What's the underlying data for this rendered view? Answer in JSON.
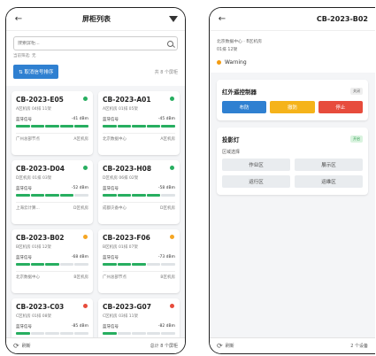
{
  "list_screen": {
    "title": "屏柜列表",
    "search_placeholder": "搜索屏柜...",
    "filter_note": "当前筛选: 无",
    "cancel_sort_label": "取消信号排序",
    "count_text": "共 8 个屏柜",
    "cards": [
      {
        "id": "CB-2023-E05",
        "sub": "A区机房 04排 11架",
        "signal_label": "蓝牙信号",
        "signal": "-41 dBm",
        "bars": 5,
        "site": "广州总部节点",
        "zone": "A区机房",
        "status": "online"
      },
      {
        "id": "CB-2023-A01",
        "sub": "A区机房 01排 05架",
        "signal_label": "蓝牙信号",
        "signal": "-45 dBm",
        "bars": 5,
        "site": "北京数据中心",
        "zone": "A区机房",
        "status": "online"
      },
      {
        "id": "CB-2023-D04",
        "sub": "D区机房 01排 03架",
        "signal_label": "蓝牙信号",
        "signal": "-52 dBm",
        "bars": 4,
        "site": "上海云计算...",
        "zone": "D区机房",
        "status": "online"
      },
      {
        "id": "CB-2023-H08",
        "sub": "D区机房 06排 02架",
        "signal_label": "蓝牙信号",
        "signal": "-58 dBm",
        "bars": 4,
        "site": "成都灾备中心",
        "zone": "D区机房",
        "status": "online"
      },
      {
        "id": "CB-2023-B02",
        "sub": "B区机房 01排 12架",
        "signal_label": "蓝牙信号",
        "signal": "-68 dBm",
        "bars": 3,
        "site": "北京数据中心",
        "zone": "B区机房",
        "status": "warning"
      },
      {
        "id": "CB-2023-F06",
        "sub": "B区机房 01排 07架",
        "signal_label": "蓝牙信号",
        "signal": "-73 dBm",
        "bars": 3,
        "site": "广州总部节点",
        "zone": "B区机房",
        "status": "warning"
      },
      {
        "id": "CB-2023-C03",
        "sub": "C区机房 01排 08架",
        "signal_label": "蓝牙信号",
        "signal": "-85 dBm",
        "bars": 1,
        "site": "",
        "zone": "",
        "status": "offline"
      },
      {
        "id": "CB-2023-G07",
        "sub": "C区机房 03排 11架",
        "signal_label": "蓝牙信号",
        "signal": "-82 dBm",
        "bars": 1,
        "site": "",
        "zone": "",
        "status": "offline"
      }
    ],
    "refresh_label": "刷新",
    "bottom_count": "总计 8 个屏柜"
  },
  "detail_screen": {
    "title": "CB-2023-B02",
    "location_line1": "北京数据中心 · B区机房",
    "location_line2": "01排 12架",
    "status_text": "Warning",
    "infrared_panel": {
      "title": "红外遥控制器",
      "tag": "关闭",
      "buttons": [
        "布防",
        "撤防",
        "停止"
      ]
    },
    "projector_panel": {
      "title": "投影灯",
      "tag": "开启",
      "zone_label": "区域选择",
      "zones": [
        "作业区",
        "展示区",
        "运行区",
        "运维区"
      ]
    },
    "refresh_label": "刷新",
    "bottom_count": "2 个设备"
  },
  "colors": {
    "online": "#27ae60",
    "warning": "#f5a623",
    "offline": "#e74c3c",
    "bar_on": "#27ae60",
    "bar_off": "#dfe3e6",
    "primary": "#2f80d1",
    "btn_arm": "#2f80d1",
    "btn_disarm": "#f5b31a",
    "btn_stop": "#e74c3c"
  },
  "icons": {
    "back": "back-arrow-icon",
    "filter": "filter-funnel-icon",
    "search": "search-icon",
    "sort": "sort-icon",
    "refresh": "refresh-icon"
  }
}
